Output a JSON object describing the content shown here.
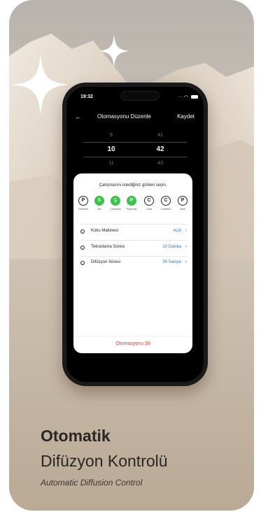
{
  "status_bar": {
    "time": "19:32",
    "signal": "....",
    "wifi_icon": "wifi-icon",
    "battery_icon": "battery-icon"
  },
  "nav": {
    "back": "←",
    "title": "Otomasyonu Düzenle",
    "save": "Kaydet"
  },
  "picker": {
    "hours": [
      "9",
      "10",
      "11"
    ],
    "minutes": [
      "41",
      "42",
      "43"
    ]
  },
  "sheet": {
    "prompt": "Çalışmasını istediğiniz günleri seçin.",
    "days": [
      {
        "letter": "P",
        "label": "Pazartesi",
        "selected": false
      },
      {
        "letter": "S",
        "label": "Salı",
        "selected": true
      },
      {
        "letter": "Ç",
        "label": "Çarşamba",
        "selected": true
      },
      {
        "letter": "P",
        "label": "Perşembe",
        "selected": true
      },
      {
        "letter": "C",
        "label": "Cuma",
        "selected": false
      },
      {
        "letter": "C",
        "label": "Cumartesi",
        "selected": false
      },
      {
        "letter": "P",
        "label": "Pazar",
        "selected": false
      }
    ],
    "settings": [
      {
        "label": "Koku Makinesi",
        "value": "Açık"
      },
      {
        "label": "Tekrarlama Süresi",
        "value": "10 Dakika"
      },
      {
        "label": "Difüzyon Süresi",
        "value": "30 Saniye"
      }
    ],
    "delete_label": "Otomasyonu Sil"
  },
  "caption": {
    "title_bold": "Otomatik",
    "title_regular": "Difüzyon Kontrolü",
    "subtitle_en": "Automatic Diffusion Control"
  },
  "colors": {
    "accent_green": "#3cc24b",
    "link_blue": "#2a7ac0",
    "danger_red": "#e53935"
  }
}
